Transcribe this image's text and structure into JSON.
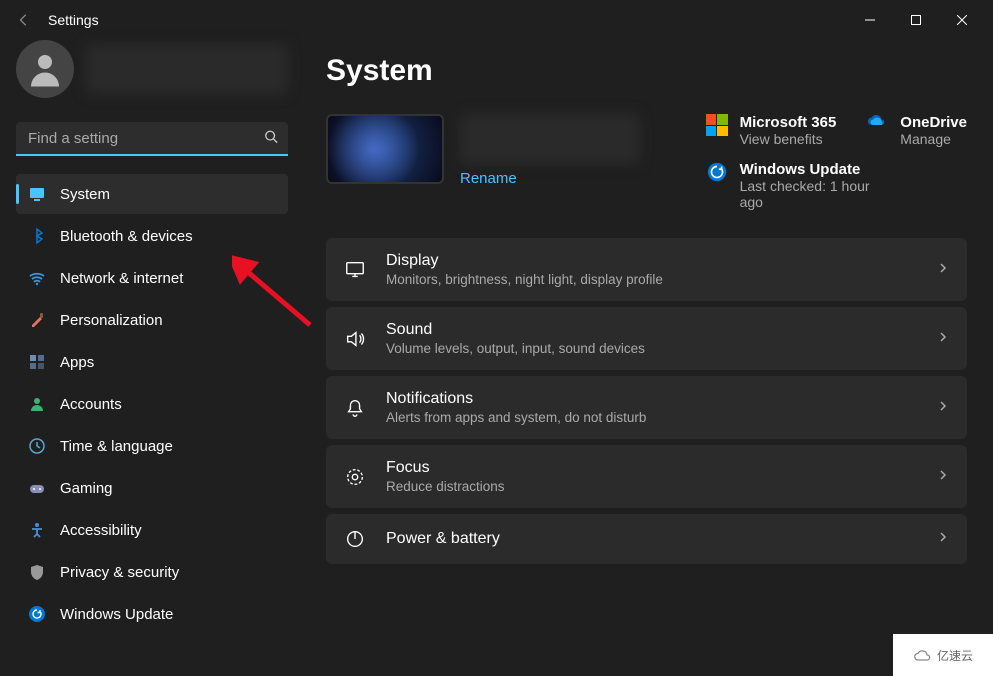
{
  "window": {
    "title": "Settings"
  },
  "search": {
    "placeholder": "Find a setting"
  },
  "nav": [
    {
      "label": "System",
      "icon": "monitor",
      "color": "#4cc2ff",
      "active": true
    },
    {
      "label": "Bluetooth & devices",
      "icon": "bluetooth",
      "color": "#0078d4"
    },
    {
      "label": "Network & internet",
      "icon": "wifi",
      "color": "#3a96dd"
    },
    {
      "label": "Personalization",
      "icon": "brush",
      "color": "#e3735e"
    },
    {
      "label": "Apps",
      "icon": "grid",
      "color": "#6b8fb5"
    },
    {
      "label": "Accounts",
      "icon": "person",
      "color": "#3cb371"
    },
    {
      "label": "Time & language",
      "icon": "clock-globe",
      "color": "#5aa7cc"
    },
    {
      "label": "Gaming",
      "icon": "gamepad",
      "color": "#8a8fb5"
    },
    {
      "label": "Accessibility",
      "icon": "accessibility",
      "color": "#4a8fd6"
    },
    {
      "label": "Privacy & security",
      "icon": "shield",
      "color": "#999"
    },
    {
      "label": "Windows Update",
      "icon": "sync",
      "color": "#0078d4"
    }
  ],
  "page": {
    "title": "System",
    "rename": "Rename"
  },
  "tiles": {
    "ms365": {
      "title": "Microsoft 365",
      "sub": "View benefits"
    },
    "onedrive": {
      "title": "OneDrive",
      "sub": "Manage"
    },
    "update": {
      "title": "Windows Update",
      "sub": "Last checked: 1 hour ago"
    }
  },
  "settings": [
    {
      "title": "Display",
      "sub": "Monitors, brightness, night light, display profile",
      "icon": "display"
    },
    {
      "title": "Sound",
      "sub": "Volume levels, output, input, sound devices",
      "icon": "sound"
    },
    {
      "title": "Notifications",
      "sub": "Alerts from apps and system, do not disturb",
      "icon": "bell"
    },
    {
      "title": "Focus",
      "sub": "Reduce distractions",
      "icon": "focus"
    },
    {
      "title": "Power & battery",
      "sub": "",
      "icon": "power"
    }
  ],
  "watermark": "亿速云"
}
